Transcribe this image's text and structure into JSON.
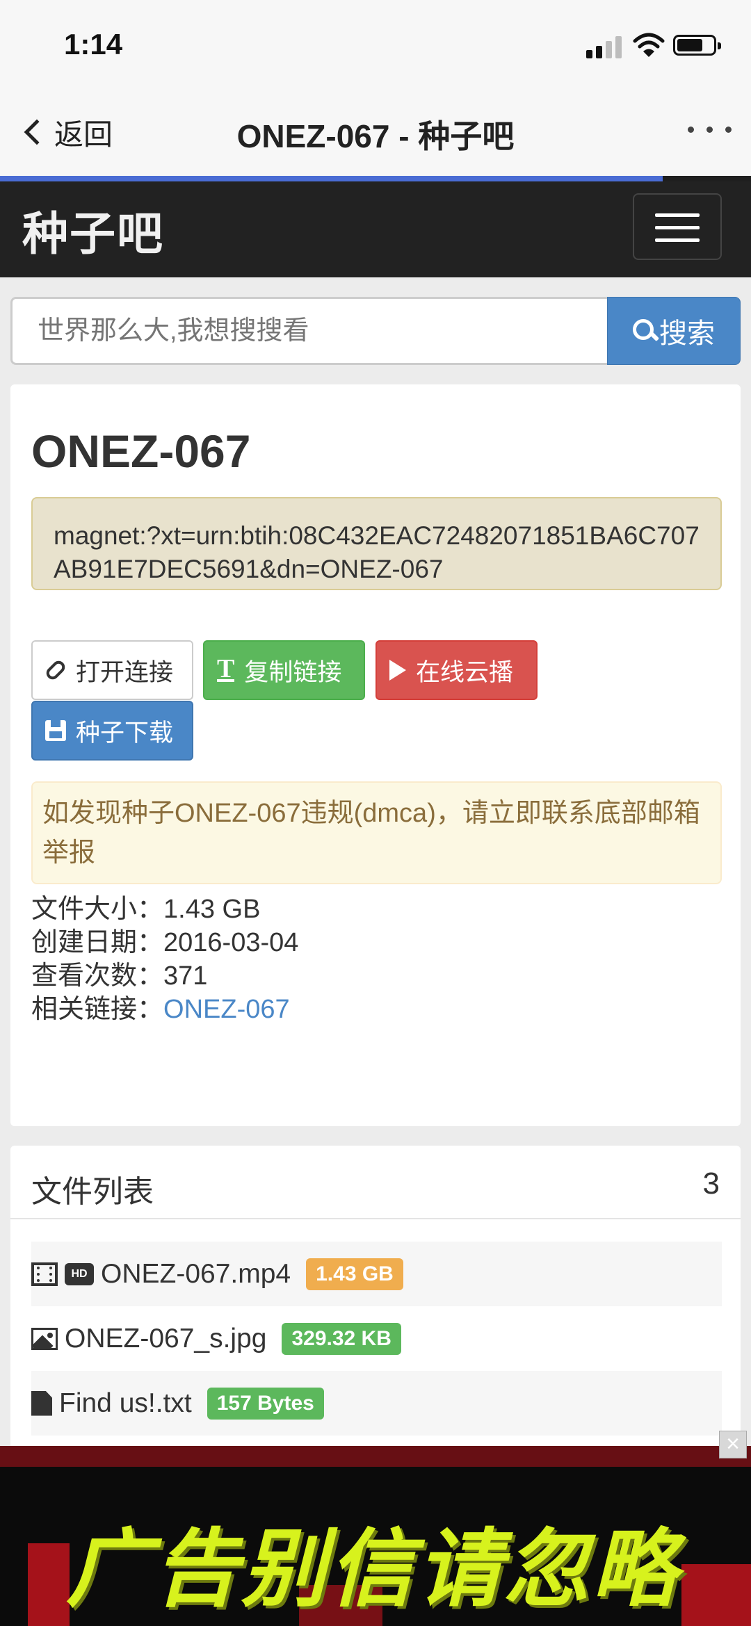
{
  "status_bar": {
    "time": "1:14"
  },
  "nav": {
    "back_label": "返回",
    "title": "ONEZ-067 - 种子吧"
  },
  "site": {
    "brand": "种子吧"
  },
  "search": {
    "placeholder": "世界那么大,我想搜搜看",
    "button_label": "搜索"
  },
  "torrent": {
    "title": "ONEZ-067",
    "magnet": "magnet:?xt=urn:btih:08C432EAC72482071851BA6C707AB91E7DEC5691&dn=ONEZ-067",
    "buttons": {
      "open": "打开连接",
      "copy": "复制链接",
      "play": "在线云播",
      "download": "种子下载"
    },
    "notice": "如发现种子ONEZ-067违规(dmca)，请立即联系底部邮箱举报",
    "meta": [
      {
        "label": "文件大小：",
        "value": "1.43 GB"
      },
      {
        "label": "创建日期：",
        "value": "2016-03-04"
      },
      {
        "label": "查看次数：",
        "value": "371"
      },
      {
        "label": "相关链接：",
        "value": "ONEZ-067"
      }
    ]
  },
  "files": {
    "title": "文件列表",
    "count": "3",
    "items": [
      {
        "name": "ONEZ-067.mp4",
        "size": "1.43 GB",
        "badge_color": "#f0ad4e"
      },
      {
        "name": "ONEZ-067_s.jpg",
        "size": "329.32 KB",
        "badge_color": "#5cb85c"
      },
      {
        "name": "Find us!.txt",
        "size": "157 Bytes",
        "badge_color": "#5cb85c"
      }
    ]
  },
  "ad": {
    "text": "广告别信请忽略",
    "close": "×"
  },
  "colors": {
    "primary": "#4a87c7",
    "success": "#5cb85c",
    "danger": "#d9534f",
    "warning": "#f0ad4e",
    "header": "#222222"
  }
}
